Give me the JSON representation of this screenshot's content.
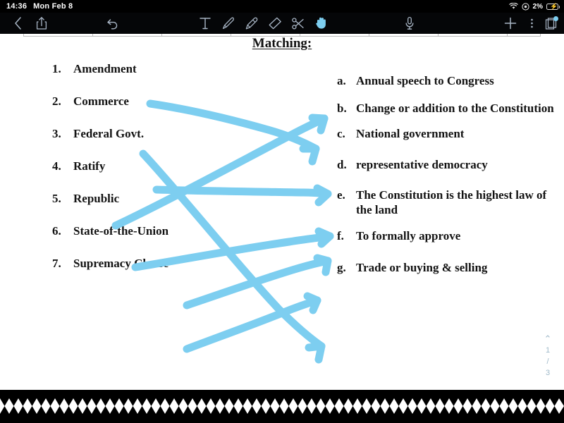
{
  "status_bar": {
    "time": "14:36",
    "date": "Mon Feb 8",
    "battery_percent": "2%",
    "icons": [
      "wifi-icon",
      "do-not-disturb-icon",
      "battery-charging-icon"
    ]
  },
  "toolbar": {
    "back_label": "‹",
    "icons": [
      "back-chevron-icon",
      "share-icon",
      "undo-icon",
      "text-tool-icon",
      "pen-tool-icon",
      "highlighter-tool-icon",
      "eraser-tool-icon",
      "scissors-tool-icon",
      "hand-tool-icon",
      "microphone-icon",
      "add-icon",
      "more-options-icon",
      "pages-icon"
    ],
    "active_tool": "hand-tool-icon",
    "accent_color": "#7dcef0"
  },
  "document": {
    "title": "Matching:",
    "terms": [
      {
        "marker": "1.",
        "text": "Amendment"
      },
      {
        "marker": "2.",
        "text": "Commerce"
      },
      {
        "marker": "3.",
        "text": "Federal Govt."
      },
      {
        "marker": "4.",
        "text": "Ratify"
      },
      {
        "marker": "5.",
        "text": "Republic"
      },
      {
        "marker": "6.",
        "text": "State-of-the-Union"
      },
      {
        "marker": "7.",
        "text": "Supremacy Clause"
      }
    ],
    "definitions": [
      {
        "marker": "a.",
        "text": "Annual speech to Congress"
      },
      {
        "marker": "b.",
        "text": "Change or addition to the Constitution"
      },
      {
        "marker": "c.",
        "text": "National government"
      },
      {
        "marker": "d.",
        "text": "representative democracy"
      },
      {
        "marker": "e.",
        "text": "The Constitution is the highest law of the land"
      },
      {
        "marker": "f.",
        "text": "To formally approve"
      },
      {
        "marker": "g.",
        "text": "Trade or buying & selling"
      }
    ],
    "ink_color": "#7dcef0"
  },
  "page_nav": {
    "up_chevron": "⌃",
    "current_page": "1",
    "separator": "/",
    "total_pages": "3"
  }
}
